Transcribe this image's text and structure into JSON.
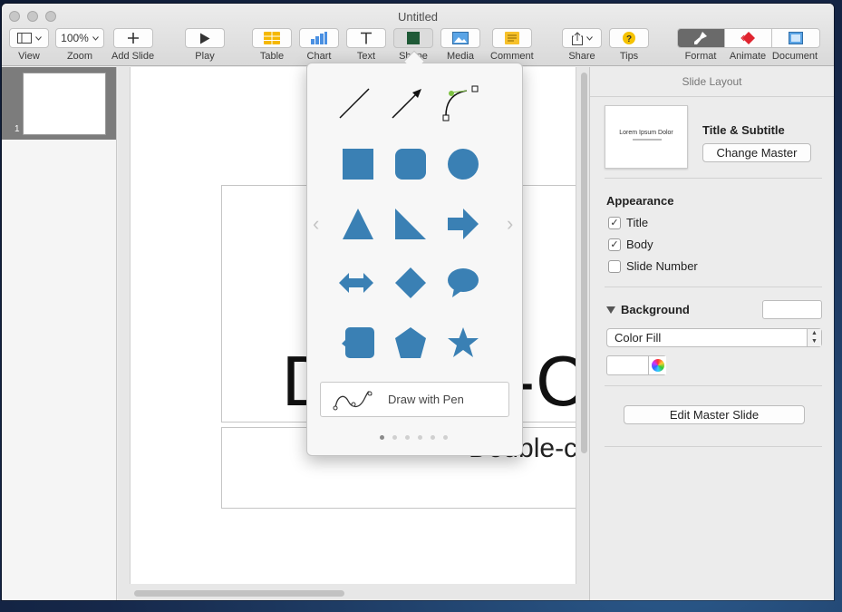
{
  "window": {
    "title": "Untitled"
  },
  "toolbar": {
    "view_label": "View",
    "zoom_value": "100%",
    "zoom_label": "Zoom",
    "add_slide_label": "Add Slide",
    "play_label": "Play",
    "table_label": "Table",
    "chart_label": "Chart",
    "text_label": "Text",
    "shape_label": "Shape",
    "media_label": "Media",
    "comment_label": "Comment",
    "share_label": "Share",
    "tips_label": "Tips",
    "format_label": "Format",
    "animate_label": "Animate",
    "document_label": "Document"
  },
  "navigator": {
    "slides": [
      {
        "number": "1"
      }
    ]
  },
  "slide": {
    "title_text": "Double-C",
    "subtitle_text": "Double-c"
  },
  "shape_popover": {
    "shapes": [
      "line",
      "arrow-line",
      "curve",
      "square",
      "rounded-square",
      "circle",
      "triangle",
      "right-triangle",
      "arrow",
      "double-arrow",
      "diamond",
      "speech-bubble",
      "callout-square",
      "pentagon",
      "star"
    ],
    "draw_with_pen_label": "Draw with Pen",
    "pages": 6,
    "current_page": 1,
    "shape_color": "#3a80b4"
  },
  "inspector": {
    "header": "Slide Layout",
    "layout_thumb_title": "Lorem Ipsum Dolor",
    "layout_name": "Title & Subtitle",
    "change_master_label": "Change Master",
    "appearance_title": "Appearance",
    "appearance_items": [
      {
        "label": "Title",
        "checked": true
      },
      {
        "label": "Body",
        "checked": true
      },
      {
        "label": "Slide Number",
        "checked": false
      }
    ],
    "background_title": "Background",
    "fill_type": "Color Fill",
    "edit_master_label": "Edit Master Slide"
  }
}
